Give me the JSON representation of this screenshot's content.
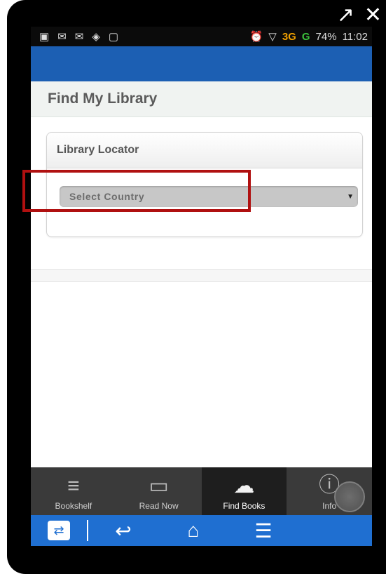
{
  "window": {
    "external_icon": "external-link-icon",
    "close_icon": "close-icon"
  },
  "status_bar": {
    "left_icons": [
      "email-icon",
      "twitter-icon",
      "mail-icon",
      "eye-icon",
      "screen-icon"
    ],
    "alarm_icon": "alarm-icon",
    "wifi_icon": "wifi-icon",
    "network_1": "3G",
    "network_2": "G",
    "battery": "74%",
    "time": "11:02"
  },
  "page": {
    "title": "Find My Library"
  },
  "card": {
    "title": "Library Locator",
    "select_placeholder": "Select Country",
    "select_caret": "▼"
  },
  "tabs": [
    {
      "label": "Bookshelf",
      "icon": "bookshelf-icon"
    },
    {
      "label": "Read Now",
      "icon": "open-book-icon"
    },
    {
      "label": "Find Books",
      "icon": "download-cloud-icon"
    },
    {
      "label": "Info",
      "icon": "info-icon"
    }
  ],
  "nav": {
    "app_icon": "teamviewer-icon",
    "back_icon": "back-icon",
    "home_icon": "home-icon",
    "menu_icon": "menu-icon"
  },
  "colors": {
    "appbar": "#1c5fb3",
    "navbar": "#1f6fd1",
    "highlight": "#b01010",
    "tabbar": "#3a3a3a"
  }
}
